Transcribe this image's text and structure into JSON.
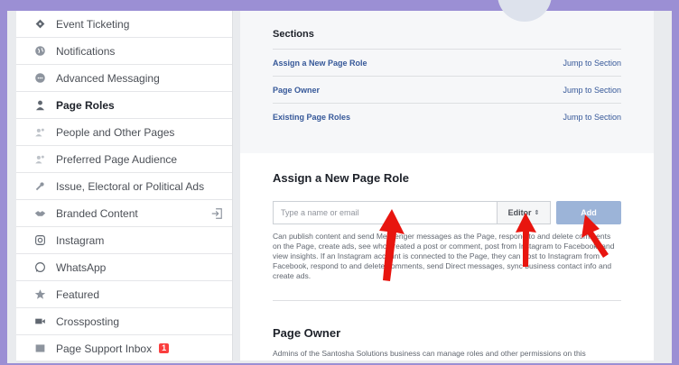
{
  "sidebar": {
    "items": [
      {
        "label": "Event Ticketing",
        "icon": "ticket-icon",
        "active": false
      },
      {
        "label": "Notifications",
        "icon": "globe-icon",
        "active": false
      },
      {
        "label": "Advanced Messaging",
        "icon": "chat-bubble-icon",
        "active": false
      },
      {
        "label": "Page Roles",
        "icon": "person-icon",
        "active": true
      },
      {
        "label": "People and Other Pages",
        "icon": "people-icon",
        "active": false
      },
      {
        "label": "Preferred Page Audience",
        "icon": "people-icon",
        "active": false
      },
      {
        "label": "Issue, Electoral or Political Ads",
        "icon": "wrench-icon",
        "active": false
      },
      {
        "label": "Branded Content",
        "icon": "handshake-icon",
        "active": false
      },
      {
        "label": "Instagram",
        "icon": "instagram-icon",
        "active": false
      },
      {
        "label": "WhatsApp",
        "icon": "whatsapp-icon",
        "active": false
      },
      {
        "label": "Featured",
        "icon": "star-icon",
        "active": false
      },
      {
        "label": "Crossposting",
        "icon": "video-camera-icon",
        "active": false
      },
      {
        "label": "Page Support Inbox",
        "icon": "inbox-icon",
        "active": false,
        "badge": "1"
      }
    ]
  },
  "sections": {
    "title": "Sections",
    "rows": [
      {
        "name": "Assign a New Page Role",
        "jump": "Jump to Section"
      },
      {
        "name": "Page Owner",
        "jump": "Jump to Section"
      },
      {
        "name": "Existing Page Roles",
        "jump": "Jump to Section"
      }
    ]
  },
  "assign": {
    "title": "Assign a New Page Role",
    "input_placeholder": "Type a name or email",
    "role": "Editor",
    "add_label": "Add",
    "description": "Can publish content and send Messenger messages as the Page, respond to and delete comments on the Page, create ads, see who created a post or comment, post from Instagram to Facebook, and view insights. If an Instagram account is connected to the Page, they can post to Instagram from Facebook, respond to and delete comments, send Direct messages, sync business contact info and create ads."
  },
  "owner": {
    "title": "Page Owner",
    "description": "Admins of the Santosha Solutions business can manage roles and other permissions on this"
  },
  "colors": {
    "accent_link": "#365899",
    "add_button": "#9cb4d8",
    "frame_border": "#9b8fd4",
    "arrow": "#e8150f"
  }
}
